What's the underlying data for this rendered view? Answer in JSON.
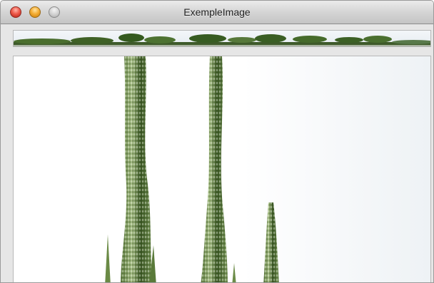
{
  "window": {
    "title": "ExempleImage"
  },
  "images": [
    {
      "name": "landscape-strip-image"
    },
    {
      "name": "tall-grass-image"
    }
  ],
  "colors": {
    "titlebar_top": "#ebebeb",
    "titlebar_bottom": "#c4c4c4",
    "window_bg": "#d9d9d9",
    "grass_dark": "#2f4a1f",
    "grass_light": "#8fae6a"
  }
}
